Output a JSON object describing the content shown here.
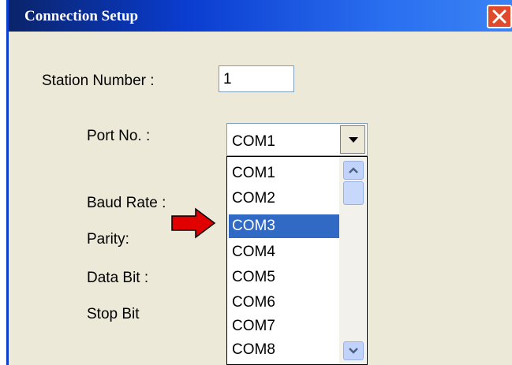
{
  "dialog": {
    "title": "Connection Setup"
  },
  "fields": {
    "station_label": "Station Number :",
    "station_value": "1",
    "port_label": "Port No. :",
    "port_value": "COM1",
    "baud_label": "Baud Rate :",
    "parity_label": "Parity:",
    "databit_label": "Data Bit :",
    "stopbit_label": "Stop Bit"
  },
  "port_options": [
    "COM1",
    "COM2",
    "COM3",
    "COM4",
    "COM5",
    "COM6",
    "COM7",
    "COM8"
  ],
  "highlighted_option": "COM3",
  "colors": {
    "titlebar": "#0a3ccf",
    "selection": "#316ac5",
    "annotation_arrow": "#e00000",
    "close_button": "#e04a2c"
  },
  "icons": {
    "close": "close-icon",
    "dropdown": "chevron-down-icon",
    "scroll_up": "scroll-up-icon",
    "scroll_down": "scroll-down-icon",
    "annotation": "red-arrow-icon"
  }
}
